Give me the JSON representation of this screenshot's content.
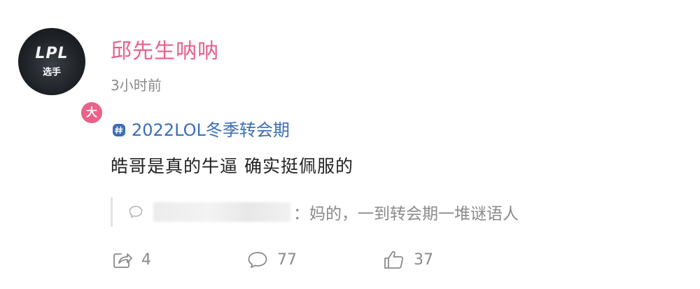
{
  "post": {
    "avatar": {
      "logo_text": "LPL",
      "sub_text": "选手",
      "badge_text": "大"
    },
    "username": "邱先生呐呐",
    "timestamp": "3小时前",
    "topic": "2022LOL冬季转会期",
    "content": "皓哥是真的牛逼 确实挺佩服的",
    "quote": {
      "text": "：妈的，一到转会期一堆谜语人"
    },
    "actions": {
      "share_count": "4",
      "comment_count": "77",
      "like_count": "37"
    }
  },
  "colors": {
    "username": "#e8618a",
    "topic": "#3b6eb6",
    "muted": "#8a8a8a",
    "badge": "#e9628a"
  },
  "icons": [
    "topic-hash-icon",
    "quote-bubble-icon",
    "share-icon",
    "comment-icon",
    "like-icon"
  ]
}
